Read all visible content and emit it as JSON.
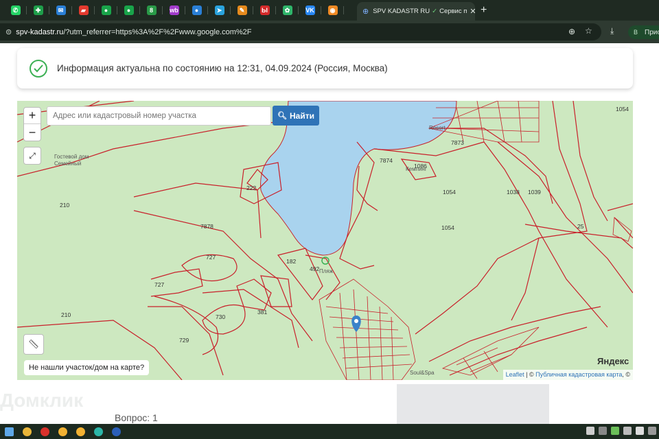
{
  "browser": {
    "pinned_tabs": [
      {
        "icon": "whatsapp-icon",
        "color": "#25d366",
        "glyph": "✆"
      },
      {
        "icon": "sheets-icon",
        "color": "#1e9e4a",
        "glyph": "✚"
      },
      {
        "icon": "mail-icon",
        "color": "#2a7fd6",
        "glyph": "✉"
      },
      {
        "icon": "gift-icon",
        "color": "#e33a2e",
        "glyph": "▰"
      },
      {
        "icon": "green-circle-icon",
        "color": "#19a44a",
        "glyph": "●"
      },
      {
        "icon": "green-circle-icon-2",
        "color": "#19a44a",
        "glyph": "●"
      },
      {
        "icon": "eight-icon",
        "color": "#2a9a48",
        "glyph": "8"
      },
      {
        "icon": "wb-icon",
        "color": "#a23ccc",
        "glyph": "wb"
      },
      {
        "icon": "chat-icon",
        "color": "#2a7fd6",
        "glyph": "●"
      },
      {
        "icon": "telegram-icon",
        "color": "#2aa3dd",
        "glyph": "➤"
      },
      {
        "icon": "pencil-icon",
        "color": "#e58a1d",
        "glyph": "✎"
      },
      {
        "icon": "red-app-icon",
        "color": "#d42b2b",
        "glyph": "Ы"
      },
      {
        "icon": "leaf-icon",
        "color": "#2fb56a",
        "glyph": "✿"
      },
      {
        "icon": "vk-icon",
        "color": "#2787f5",
        "glyph": "VK"
      },
      {
        "icon": "orange-app-icon",
        "color": "#f08a24",
        "glyph": "◉"
      }
    ],
    "active_tab": {
      "title": "SPV KADASTR RU",
      "subtitle": "Сервис п",
      "close": "✕"
    },
    "new_tab": "+",
    "url_host": "spv-kadastr.ru",
    "url_rest": "/?utm_referrer=https%3A%2F%2Fwww.google.com%2F",
    "profile_initial": "В",
    "profile_label": "Прио"
  },
  "info": {
    "text": "Информация актуальна по состоянию на 12:31, 04.09.2024 (Россия, Москва)",
    "status_color": "#3cb054"
  },
  "map": {
    "zoom_in": "+",
    "zoom_out": "−",
    "search_placeholder": "Адрес или кадастровый номер участка",
    "find_label": "Найти",
    "not_found": "Не нашли участок/дом на карте?",
    "yandex": "Яндекс",
    "attribution_leaflet": "Leaflet",
    "attribution_sep": " | © ",
    "attribution_source": "Публичная кадастровая карта",
    "attribution_tail": ", ©",
    "lake_color": "#a9d3ee",
    "land_color": "#cde8c0",
    "parcel_color": "#c8202a",
    "parcel_numbers": [
      {
        "label": "210"
      },
      {
        "label": "222"
      },
      {
        "label": "7878"
      },
      {
        "label": "727"
      },
      {
        "label": "727"
      },
      {
        "label": "182"
      },
      {
        "label": "492"
      },
      {
        "label": "730"
      },
      {
        "label": "381"
      },
      {
        "label": "729"
      },
      {
        "label": "210"
      },
      {
        "label": "7874"
      },
      {
        "label": "1086"
      },
      {
        "label": "7873"
      },
      {
        "label": "1054"
      },
      {
        "label": "1054"
      },
      {
        "label": "1038"
      },
      {
        "label": "1039"
      },
      {
        "label": "1054"
      },
      {
        "label": "25"
      }
    ],
    "places": [
      {
        "label": "Гостевой дом"
      },
      {
        "label": "Семейный"
      },
      {
        "label": "Resort"
      },
      {
        "label": "Кемпинг"
      },
      {
        "label": "Soul&Spa"
      },
      {
        "label": "Пляж"
      }
    ]
  },
  "page": {
    "watermark": "Домклик",
    "question": "Вопрос: 1"
  },
  "taskbar": {
    "apps": [
      {
        "icon": "explorer-icon",
        "color": "#e9b63a"
      },
      {
        "icon": "vivaldi-icon",
        "color": "#d9322c"
      },
      {
        "icon": "chrome-icon",
        "color": "#f2b233"
      },
      {
        "icon": "chrome-icon-2",
        "color": "#f2b233"
      },
      {
        "icon": "edge-icon",
        "color": "#2bb6a8"
      },
      {
        "icon": "word-icon",
        "color": "#2b5fb8"
      }
    ]
  }
}
